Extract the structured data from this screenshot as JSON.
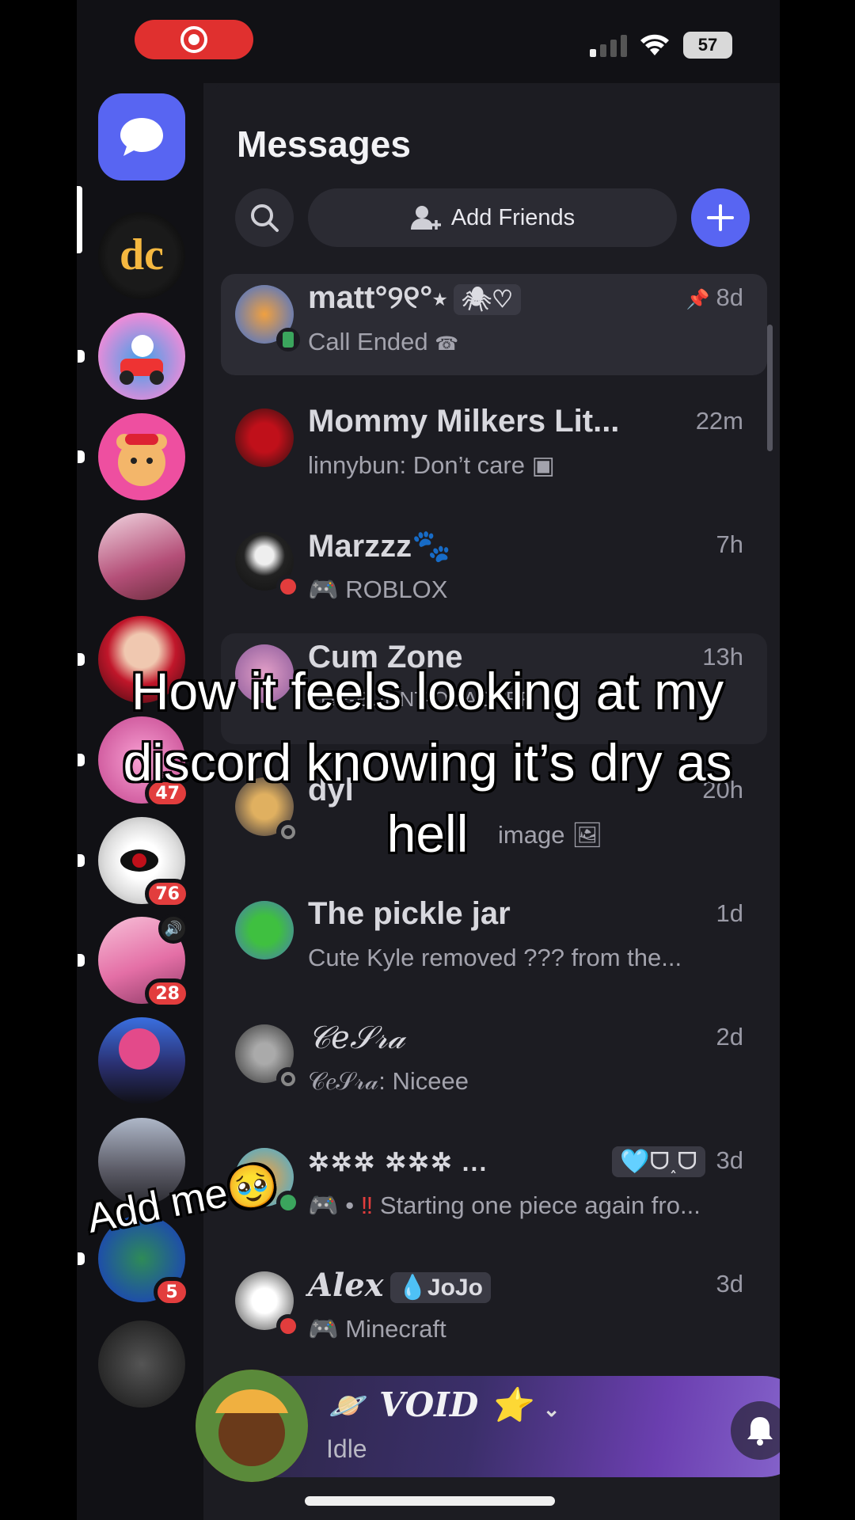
{
  "status_bar": {
    "battery": "57"
  },
  "header": {
    "title": "Messages",
    "add_friends_label": "Add Friends"
  },
  "servers": [
    {
      "name": "dc-server",
      "badge": ""
    },
    {
      "name": "kart-server",
      "badge": ""
    },
    {
      "name": "bear-server",
      "badge": ""
    },
    {
      "name": "anime-group-server",
      "badge": ""
    },
    {
      "name": "red-hair-server",
      "badge": ""
    },
    {
      "name": "pink-server",
      "badge": "47"
    },
    {
      "name": "eye-server",
      "badge": "76"
    },
    {
      "name": "pink-anime-server",
      "badge": "28"
    },
    {
      "name": "pink-head-server",
      "badge": ""
    },
    {
      "name": "group-photo-server",
      "badge": ""
    },
    {
      "name": "earth-server",
      "badge": "5"
    },
    {
      "name": "dark-server",
      "badge": ""
    }
  ],
  "dms": [
    {
      "name": "matt°୨୧°⋆",
      "tag": "🕷♡",
      "time": "8d",
      "subtitle": "Call Ended"
    },
    {
      "name": "Mommy Milkers Lit...",
      "time": "22m",
      "subtitle": "linnybun: Don’t care"
    },
    {
      "name": "Marzzz🐾",
      "time": "7h",
      "subtitle": "ROBLOX"
    },
    {
      "name": "Cum Zone",
      "time": "13h",
      "subtitle": "THE-BURNT-QUACKER"
    },
    {
      "name": "dyl",
      "time": "20h",
      "subtitle": "image"
    },
    {
      "name": "The pickle jar",
      "time": "1d",
      "subtitle": "Cute Kyle removed ??? from the..."
    },
    {
      "name": "𝒞𝑒𝒮𝓇𝒶",
      "time": "2d",
      "subtitle": "𝒞𝑒𝒮𝓇𝒶: Niceee"
    },
    {
      "name": "✲✲✲ ✲✲✲ ...",
      "tag": "🩵ᗜ˰ᗜ",
      "time": "3d",
      "subtitle": "Starting one piece again fro..."
    },
    {
      "name": "Alex",
      "tag": "💧JoJo",
      "time": "3d",
      "subtitle": "Minecraft"
    }
  ],
  "user": {
    "name": "𝑽𝑶𝑰𝑫 ⭐",
    "status": "Idle"
  },
  "captions": {
    "main": "How it feels looking at my discord knowing it’s dry as hell",
    "add_me": "Add me🥹"
  },
  "colors": {
    "blurple": "#5865f2",
    "badge_red": "#e23d3d",
    "online_green": "#3ba55d",
    "dnd_red": "#e23d3d"
  }
}
